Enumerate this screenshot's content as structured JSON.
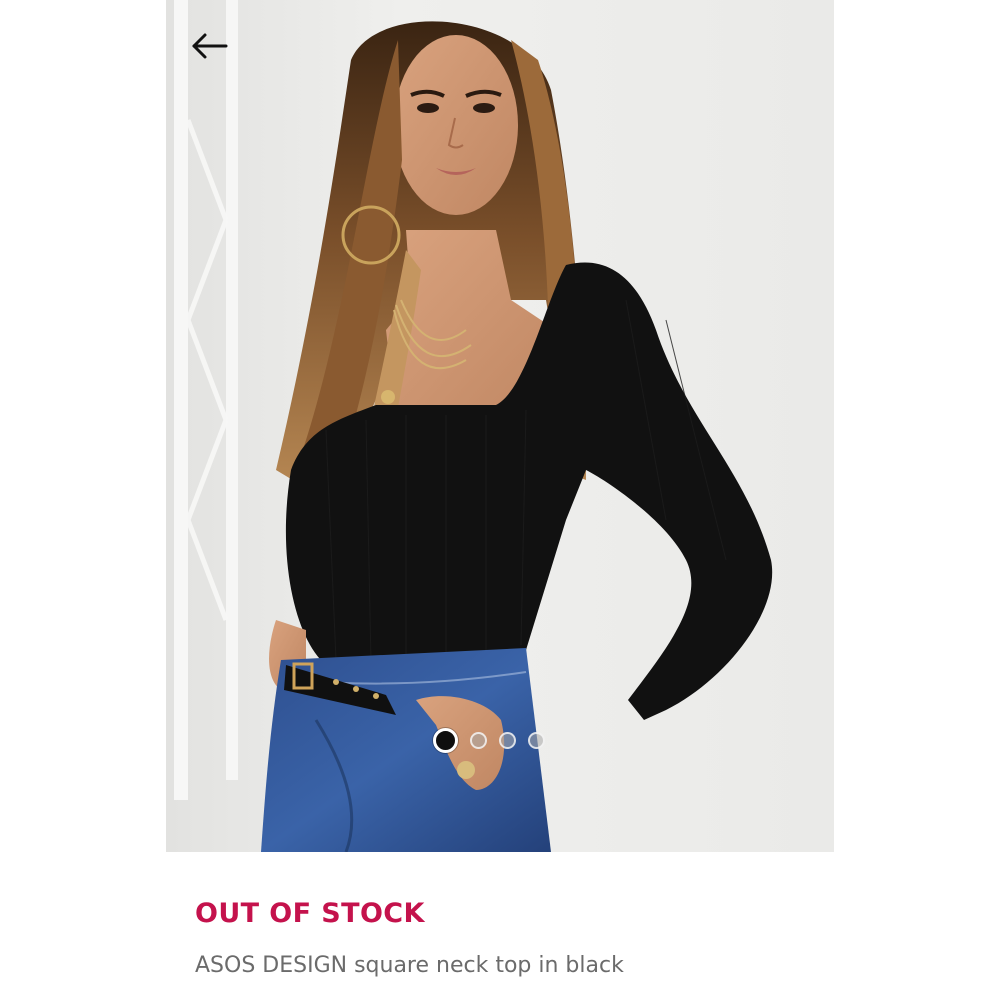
{
  "product": {
    "stock_status": "OUT OF STOCK",
    "title": "ASOS DESIGN square neck top in black"
  },
  "carousel": {
    "image_count": 4,
    "active_index": 0
  },
  "icons": {
    "back": "arrow-left-icon"
  },
  "colors": {
    "stock_status": "#c4124c",
    "title_text": "#6b6b6b",
    "background": "#ffffff"
  }
}
